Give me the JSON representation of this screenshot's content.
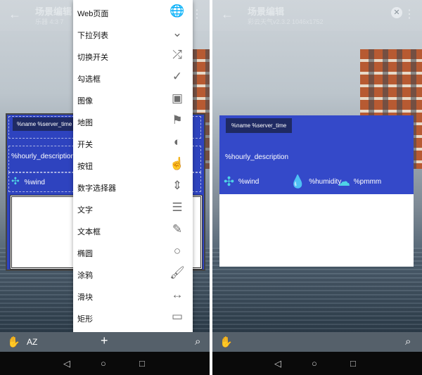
{
  "left_screen": {
    "title": "场景编辑",
    "subtitle": "乐器 4:3 7",
    "widget": {
      "name_badge": "%name  %server_time",
      "hourly": "%hourly_description",
      "wind": "%wind"
    },
    "menu_items": [
      {
        "label": "Web页面",
        "icon": "globe-icon"
      },
      {
        "label": "下拉列表",
        "icon": "chevron-down-icon"
      },
      {
        "label": "切换开关",
        "icon": "shuffle-icon"
      },
      {
        "label": "勾选框",
        "icon": "check-icon"
      },
      {
        "label": "图像",
        "icon": "image-icon"
      },
      {
        "label": "地图",
        "icon": "flag-icon"
      },
      {
        "label": "开关",
        "icon": "contrast-icon"
      },
      {
        "label": "按钮",
        "icon": "touch-icon"
      },
      {
        "label": "数字选择器",
        "icon": "unfold-icon"
      },
      {
        "label": "文字",
        "icon": "text-lines-icon"
      },
      {
        "label": "文本框",
        "icon": "pencil-icon"
      },
      {
        "label": "椭圆",
        "icon": "circle-icon"
      },
      {
        "label": "涂鸦",
        "icon": "brush-icon"
      },
      {
        "label": "滑块",
        "icon": "slider-icon"
      },
      {
        "label": "矩形",
        "icon": "rectangle-icon"
      }
    ],
    "bottom": {
      "az_label": "AZ",
      "plus_label": "+"
    }
  },
  "right_screen": {
    "title": "场景编辑",
    "subtitle": "彩云天气v2.3.2 1046x1752",
    "widget": {
      "name_badge": "%name  %server_time",
      "hourly": "%hourly_description",
      "wind": "%wind",
      "humidity": "%humidity",
      "pm": "%pmmm"
    }
  },
  "colors": {
    "widget_blue": "#3449c9",
    "badge_navy": "#1f2a63"
  }
}
